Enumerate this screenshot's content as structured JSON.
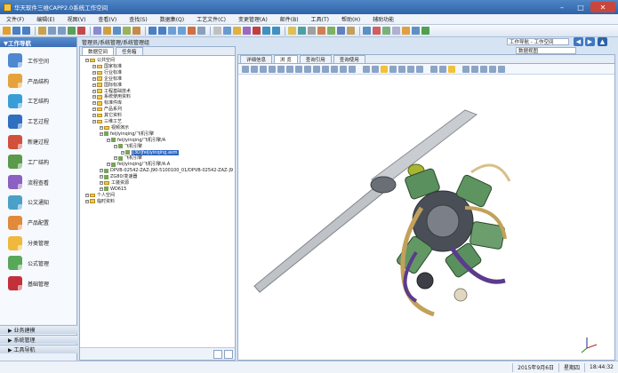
{
  "window": {
    "title": "华天软件三维CAPP2.0系统工作空间"
  },
  "menu": [
    "文件(F)",
    "编辑(E)",
    "视图(V)",
    "查看(V)",
    "查找(S)",
    "数据集(Q)",
    "工艺文件(C)",
    "变更管理(A)",
    "邮件(B)",
    "工具(T)",
    "帮助(H)",
    "辅助功能"
  ],
  "left_panel": {
    "header": "▼工作导航",
    "items": [
      "工作空间",
      "产品结构",
      "工艺结构",
      "工艺过程",
      "新建过程",
      "工厂结构",
      "流程查看",
      "公文通知",
      "产品配置",
      "分类管理",
      "公式管理",
      "基础管理"
    ],
    "bottom": [
      "▶ 业务建模",
      "▶ 系统管理",
      "▶ 工具导航"
    ]
  },
  "breadcrumb": "管理员/系统管理/系统管理组",
  "workspace_select": "工作导航 - 工作空间",
  "view_select": "数据视图",
  "tree_tabs": [
    "数据空间",
    "任务箱"
  ],
  "tree": [
    {
      "text": "公共空间",
      "level": 0,
      "type": "folder"
    },
    {
      "text": "国家标准",
      "level": 1,
      "type": "folder"
    },
    {
      "text": "行业标准",
      "level": 1,
      "type": "folder"
    },
    {
      "text": "企业标准",
      "level": 1,
      "type": "folder"
    },
    {
      "text": "国际标准",
      "level": 1,
      "type": "folder"
    },
    {
      "text": "工程基础技术",
      "level": 1,
      "type": "folder"
    },
    {
      "text": "系统使用资料",
      "level": 1,
      "type": "folder"
    },
    {
      "text": "标准件库",
      "level": 1,
      "type": "folder"
    },
    {
      "text": "产品系列",
      "level": 1,
      "type": "folder"
    },
    {
      "text": "其它资料",
      "level": 1,
      "type": "folder"
    },
    {
      "text": "三维工艺",
      "level": 1,
      "type": "folder"
    },
    {
      "text": "视频演示",
      "level": 2,
      "type": "folder"
    },
    {
      "text": "feijiyinqing/飞机引擎",
      "level": 2,
      "type": "doc"
    },
    {
      "text": "feijiyinqing/飞机引擎/A",
      "level": 3,
      "type": "doc"
    },
    {
      "text": "飞机引擎",
      "level": 4,
      "type": "doc"
    },
    {
      "text": "[3D]feijiyinqing.asm",
      "level": 5,
      "type": "doc",
      "selected": true
    },
    {
      "text": "飞机引擎",
      "level": 4,
      "type": "doc"
    },
    {
      "text": "feijiyinqing/飞机引擎/A.A",
      "level": 3,
      "type": "doc"
    },
    {
      "text": "DPVB-02542-ZAZ-J90-5100100_01/DPVB-02542-ZAZ-J9",
      "level": 2,
      "type": "doc"
    },
    {
      "text": "ZG80/变速器",
      "level": 2,
      "type": "doc"
    },
    {
      "text": "工装资源",
      "level": 2,
      "type": "folder"
    },
    {
      "text": "WD615",
      "level": 2,
      "type": "doc"
    },
    {
      "text": "个人空间",
      "level": 0,
      "type": "folder"
    },
    {
      "text": "临时资料",
      "level": 0,
      "type": "folder"
    }
  ],
  "viewer_tabs": [
    "详细信息",
    "浏 览",
    "查询引用",
    "查询使用"
  ],
  "status": {
    "date": "2015年9月6日",
    "weekday": "星期四",
    "time": "18:44:32"
  },
  "colors": {
    "accent": "#3a6db5",
    "titlebar": "#2f62a8",
    "selection": "#3167c2"
  }
}
